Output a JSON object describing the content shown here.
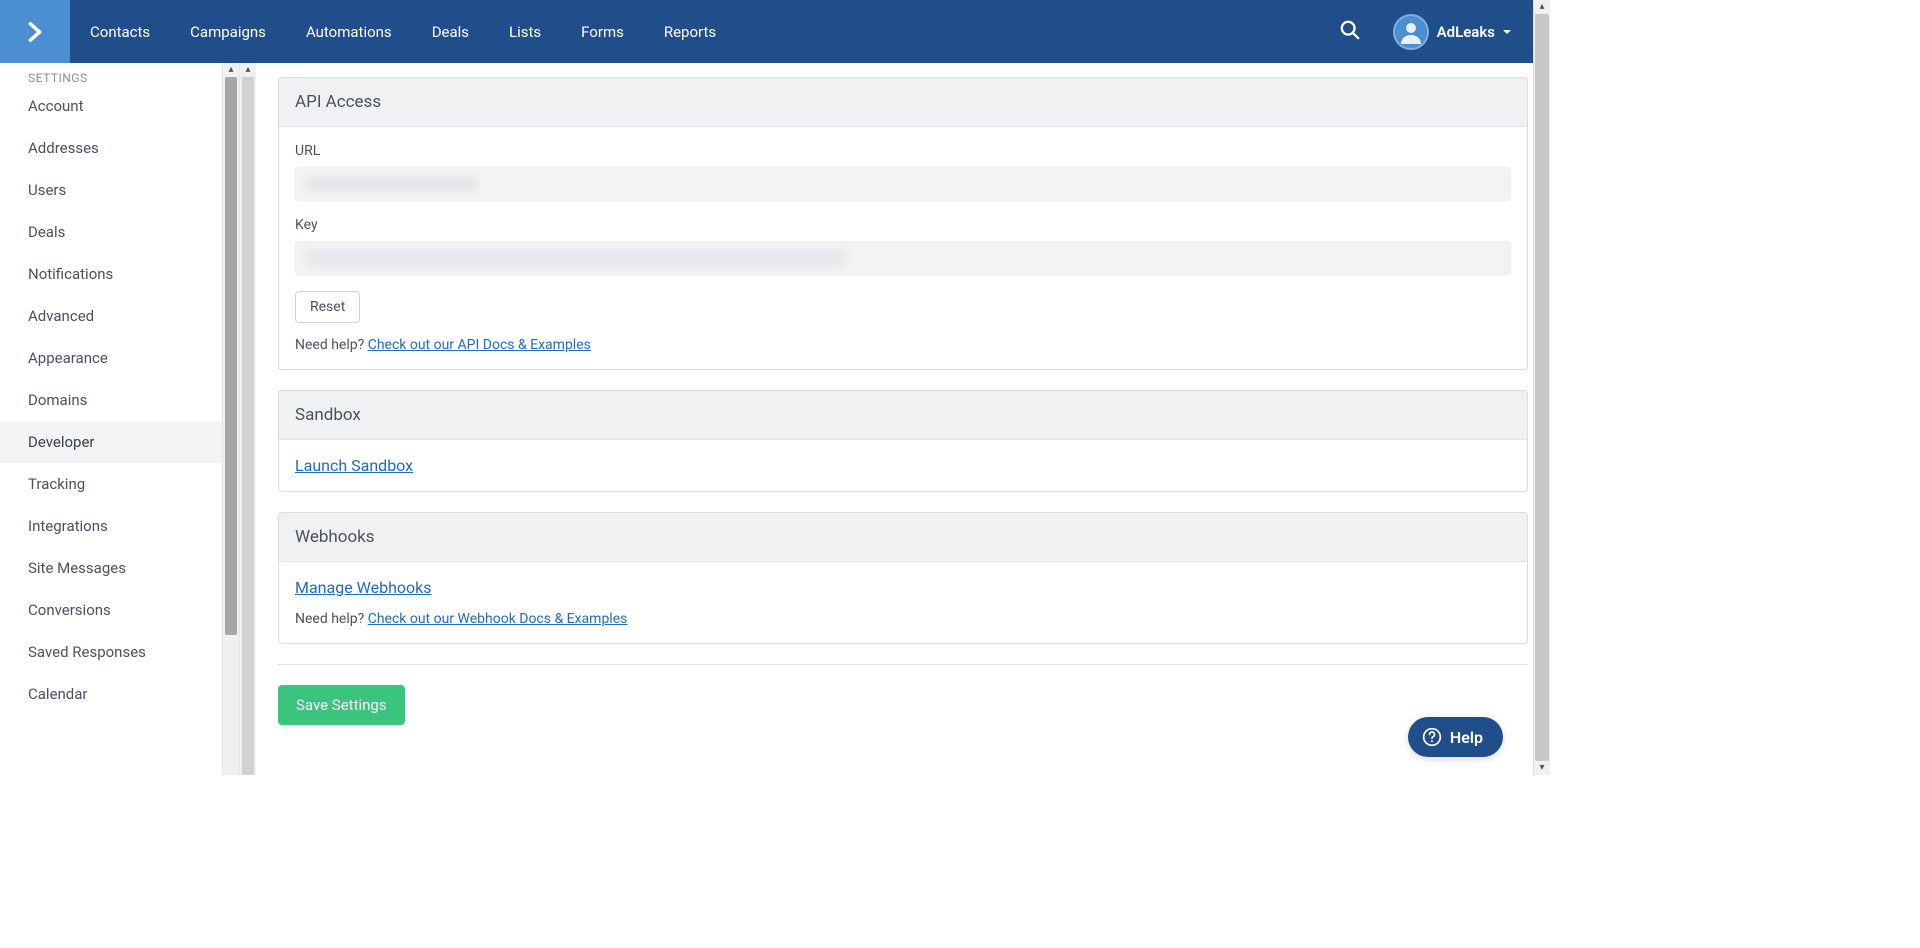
{
  "nav": {
    "items": [
      "Contacts",
      "Campaigns",
      "Automations",
      "Deals",
      "Lists",
      "Forms",
      "Reports"
    ],
    "user": "AdLeaks"
  },
  "sidebar": {
    "header": "SETTINGS",
    "items": [
      "Account",
      "Addresses",
      "Users",
      "Deals",
      "Notifications",
      "Advanced",
      "Appearance",
      "Domains",
      "Developer",
      "Tracking",
      "Integrations",
      "Site Messages",
      "Conversions",
      "Saved Responses",
      "Calendar"
    ],
    "active_index": 8
  },
  "panels": {
    "api": {
      "title": "API Access",
      "url_label": "URL",
      "key_label": "Key",
      "reset_label": "Reset",
      "help_prefix": "Need help? ",
      "help_link": "Check out our API Docs & Examples"
    },
    "sandbox": {
      "title": "Sandbox",
      "link": "Launch Sandbox"
    },
    "webhooks": {
      "title": "Webhooks",
      "link": "Manage Webhooks",
      "help_prefix": "Need help? ",
      "help_link": "Check out our Webhook Docs & Examples"
    }
  },
  "buttons": {
    "save": "Save Settings",
    "help_fab": "Help"
  }
}
